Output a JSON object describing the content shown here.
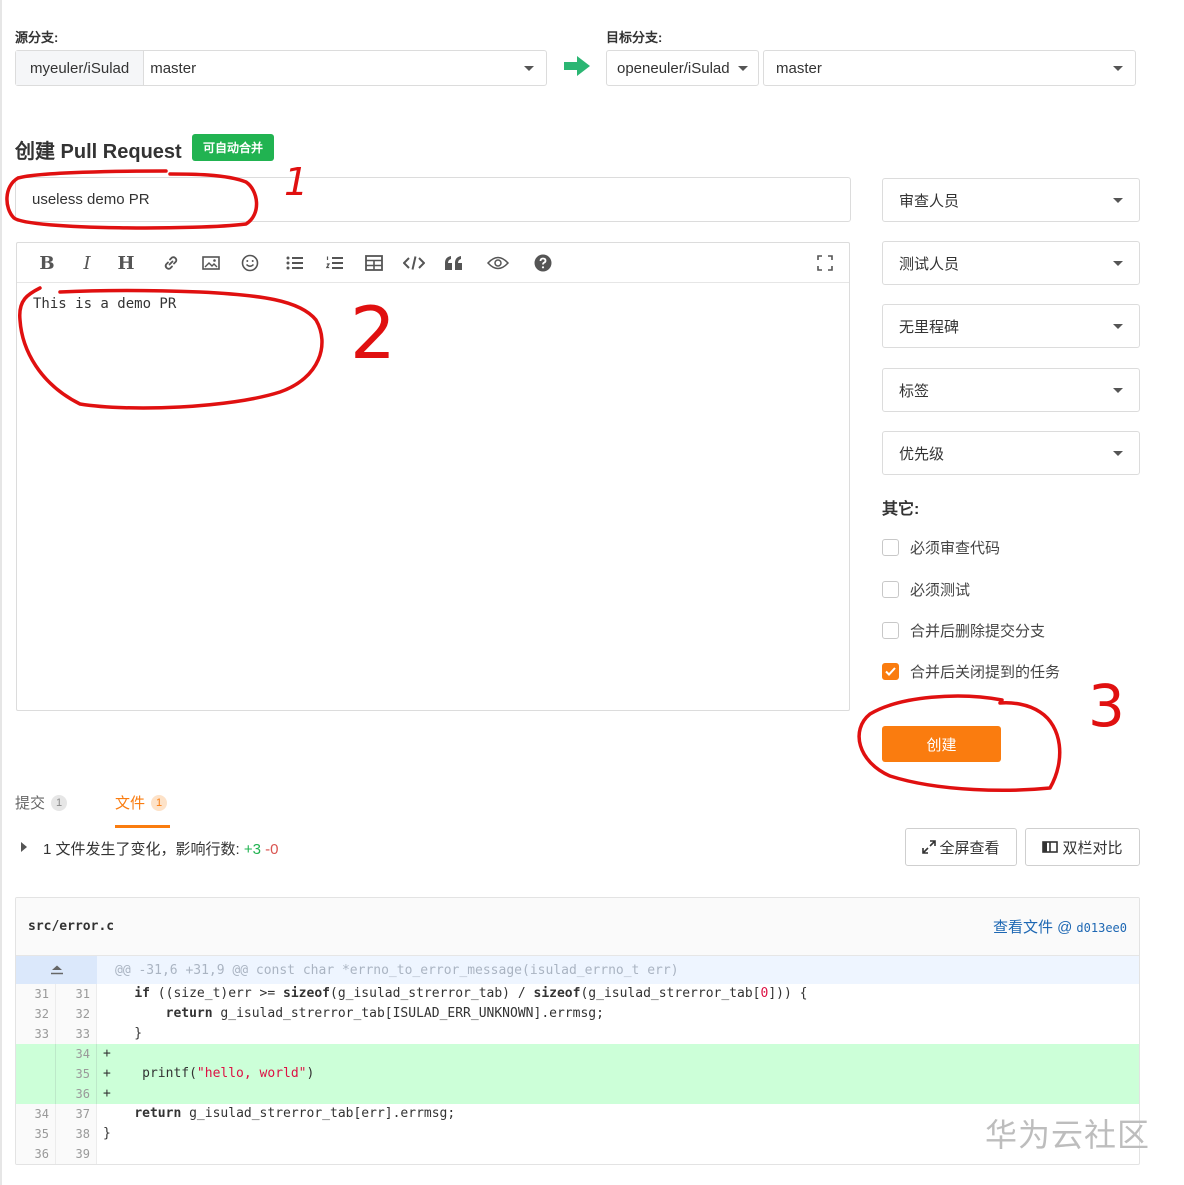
{
  "source": {
    "label": "源分支:",
    "repo": "myeuler/iSulad",
    "branch": "master"
  },
  "target": {
    "label": "目标分支:",
    "repo": "openeuler/iSulad",
    "branch": "master"
  },
  "header": {
    "title": "创建 Pull Request",
    "badge": "可自动合并"
  },
  "pr": {
    "title": "useless demo PR",
    "body": "This is a demo PR"
  },
  "toolbar": {
    "bold": "B",
    "italic": "I",
    "heading": "H",
    "items": [
      "bold",
      "italic",
      "heading",
      "link",
      "image",
      "emoji",
      "bullet-list",
      "ordered-list",
      "table",
      "code",
      "quote",
      "preview",
      "help",
      "fullscreen"
    ]
  },
  "sidebar": {
    "selects": [
      "审查人员",
      "测试人员",
      "无里程碑",
      "标签",
      "优先级"
    ],
    "other_label": "其它:",
    "options": [
      {
        "label": "必须审查代码",
        "checked": false
      },
      {
        "label": "必须测试",
        "checked": false
      },
      {
        "label": "合并后删除提交分支",
        "checked": false
      },
      {
        "label": "合并后关闭提到的任务",
        "checked": true
      }
    ],
    "create_label": "创建"
  },
  "tabs": [
    {
      "label": "提交",
      "count": "1",
      "active": false
    },
    {
      "label": "文件",
      "count": "1",
      "active": true
    }
  ],
  "summary": {
    "text": "1 文件发生了变化，影响行数:",
    "added": "+3",
    "removed": "-0"
  },
  "actions": {
    "fullscreen": "全屏查看",
    "split": "双栏对比"
  },
  "diff": {
    "file": "src/error.c",
    "view_file": "查看文件 @",
    "hash": "d013ee0",
    "hunk": "@@ -31,6 +31,9 @@ const char *errno_to_error_message(isulad_errno_t err)",
    "lines": [
      {
        "old": "31",
        "new": "31",
        "type": "ctx",
        "code": "    if ((size_t)err >= sizeof(g_isulad_strerror_tab) / sizeof(g_isulad_strerror_tab[0])) {"
      },
      {
        "old": "32",
        "new": "32",
        "type": "ctx",
        "code": "        return g_isulad_strerror_tab[ISULAD_ERR_UNKNOWN].errmsg;"
      },
      {
        "old": "33",
        "new": "33",
        "type": "ctx",
        "code": "    }"
      },
      {
        "old": "",
        "new": "34",
        "type": "add",
        "code": "+"
      },
      {
        "old": "",
        "new": "35",
        "type": "add",
        "code": "+    printf(\"hello, world\")"
      },
      {
        "old": "",
        "new": "36",
        "type": "add",
        "code": "+"
      },
      {
        "old": "34",
        "new": "37",
        "type": "ctx",
        "code": "    return g_isulad_strerror_tab[err].errmsg;"
      },
      {
        "old": "35",
        "new": "38",
        "type": "ctx",
        "code": "}"
      },
      {
        "old": "36",
        "new": "39",
        "type": "ctx",
        "code": ""
      }
    ]
  },
  "annotations": {
    "n1": "1",
    "n2": "2",
    "n3": "3",
    "color": "#e01010"
  },
  "watermark": "华为云社区",
  "colors": {
    "accent": "#fa7c0f",
    "green": "#21b351",
    "arrow": "#2bb673",
    "link": "#1d67b3"
  }
}
